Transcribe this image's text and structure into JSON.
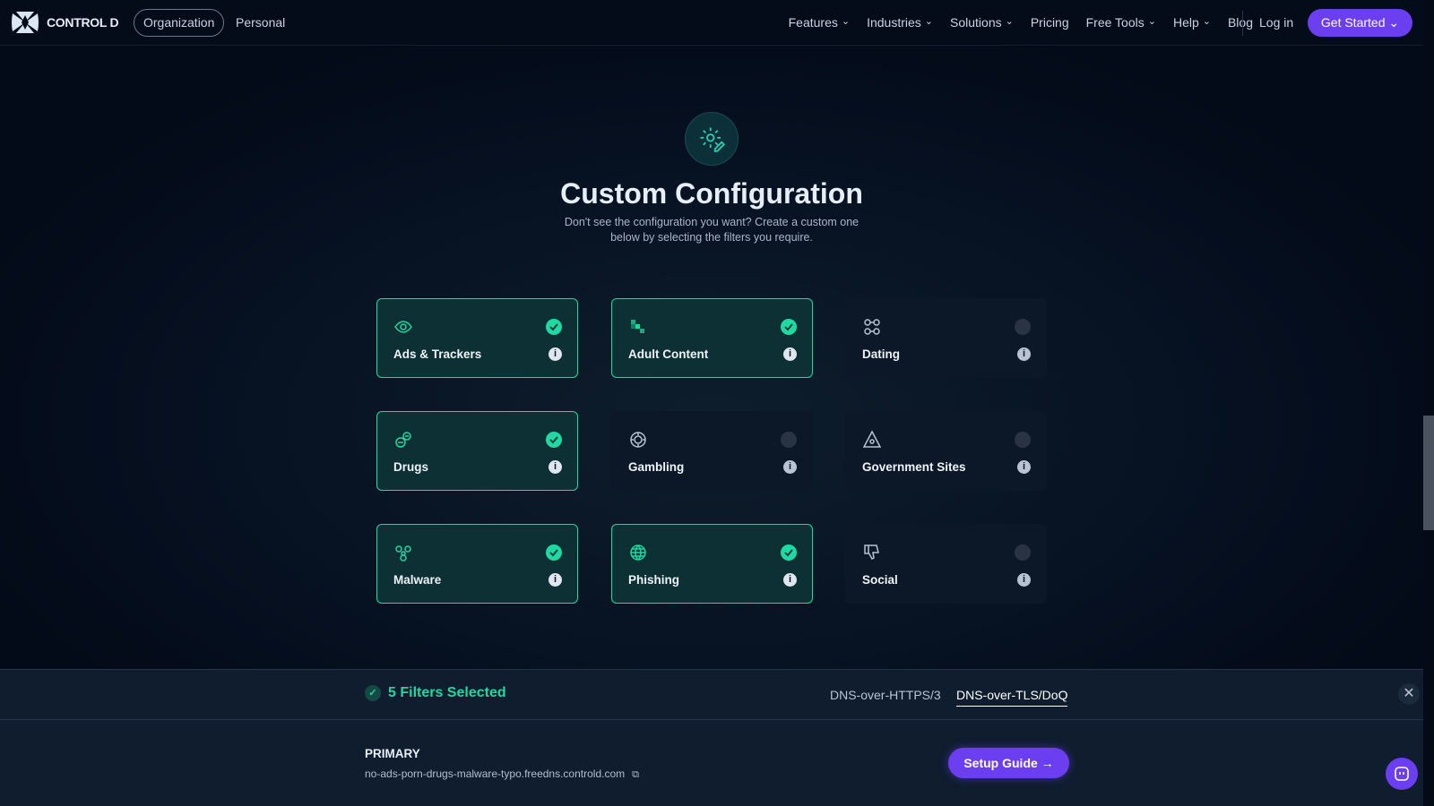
{
  "nav": {
    "brand": "CONTROL D",
    "org": "Organization",
    "personal": "Personal",
    "menu": [
      {
        "label": "Features",
        "dropdown": true
      },
      {
        "label": "Industries",
        "dropdown": true
      },
      {
        "label": "Solutions",
        "dropdown": true
      },
      {
        "label": "Pricing",
        "dropdown": false
      },
      {
        "label": "Free Tools",
        "dropdown": true
      },
      {
        "label": "Help",
        "dropdown": true
      },
      {
        "label": "Blog",
        "dropdown": false
      }
    ],
    "login": "Log in",
    "cta": "Get Started ⌄"
  },
  "hero": {
    "title": "Custom Configuration",
    "subtitle1": "Don't see the configuration you want? Create a custom one",
    "subtitle2": "below by selecting the filters you require."
  },
  "filters": [
    {
      "label": "Ads & Trackers",
      "icon": "eye-icon",
      "selected": true
    },
    {
      "label": "Adult Content",
      "icon": "pixel-icon",
      "selected": true
    },
    {
      "label": "Dating",
      "icon": "dating-icon",
      "selected": false
    },
    {
      "label": "Drugs",
      "icon": "pills-icon",
      "selected": true
    },
    {
      "label": "Gambling",
      "icon": "chip-icon",
      "selected": false
    },
    {
      "label": "Government Sites",
      "icon": "pyramid-icon",
      "selected": false
    },
    {
      "label": "Malware",
      "icon": "biohazard-icon",
      "selected": true
    },
    {
      "label": "Phishing",
      "icon": "globe-icon",
      "selected": true
    },
    {
      "label": "Social",
      "icon": "thumbs-down-icon",
      "selected": false
    }
  ],
  "panel": {
    "count": "5 Filters Selected",
    "tabs": [
      "DNS-over-HTTPS/3",
      "DNS-over-TLS/DoQ"
    ],
    "active_tab": 1,
    "primary_label": "PRIMARY",
    "hostname": "no-ads-porn-drugs-malware-typo.freedns.controld.com",
    "setup": "Setup Guide →"
  },
  "colors": {
    "accent": "#1fd9a3",
    "brand": "#6b3ff0"
  }
}
